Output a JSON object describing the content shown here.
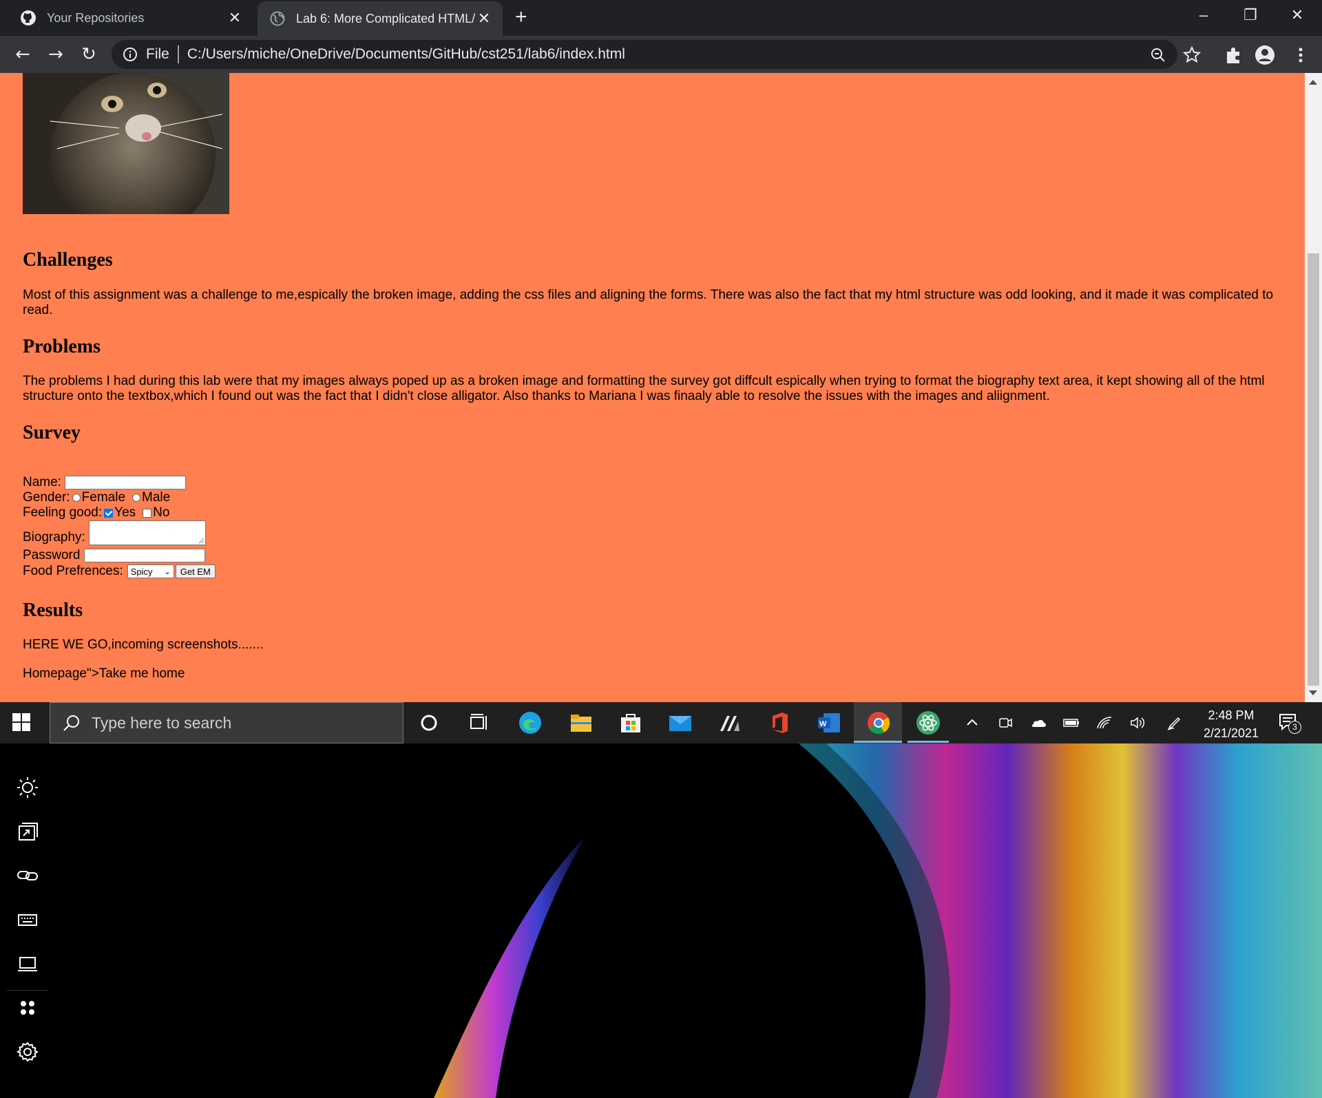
{
  "browser": {
    "tabs": [
      {
        "title": "Your Repositories",
        "icon": "github-icon",
        "active": false
      },
      {
        "title": "Lab 6: More Complicated HTML/",
        "icon": "globe-icon",
        "active": true
      }
    ],
    "scheme_label": "File",
    "url": "C:/Users/miche/OneDrive/Documents/GitHub/cst251/lab6/index.html"
  },
  "page": {
    "background": "#ff7f50",
    "challenges": {
      "heading": "Challenges",
      "text": "Most of this assignment was a challenge to me,espically the broken image, adding the css files and aligning the forms. There was also the fact that my html structure was odd looking, and it made it was complicated to read."
    },
    "problems": {
      "heading": "Problems",
      "text": "The problems I had during this lab were that my images always poped up as a broken image and formatting the survey got diffcult espically when trying to format the biography text area, it kept showing all of the html structure onto the textbox,which I found out was the fact that I didn't close alligator. Also thanks to Mariana I was finaaly able to resolve the issues with the images and aliignment."
    },
    "survey": {
      "heading": "Survey",
      "name_label": "Name:",
      "gender_label": "Gender:",
      "gender_options": [
        "Female",
        "Male"
      ],
      "feeling_label": "Feeling good:",
      "feeling_options": [
        {
          "label": "Yes",
          "checked": true
        },
        {
          "label": "No",
          "checked": false
        }
      ],
      "biography_label": "Biography:",
      "password_label": "Password",
      "food_label": "Food Prefrences:",
      "food_selected": "Spicy",
      "submit_label": "Get EM"
    },
    "results": {
      "heading": "Results",
      "text": "HERE WE GO,incoming screenshots.......",
      "home_link": "Homepage\">Take me home"
    }
  },
  "taskbar": {
    "search_placeholder": "Type here to search",
    "time": "2:48 PM",
    "date": "2/21/2021",
    "notification_count": "3"
  }
}
